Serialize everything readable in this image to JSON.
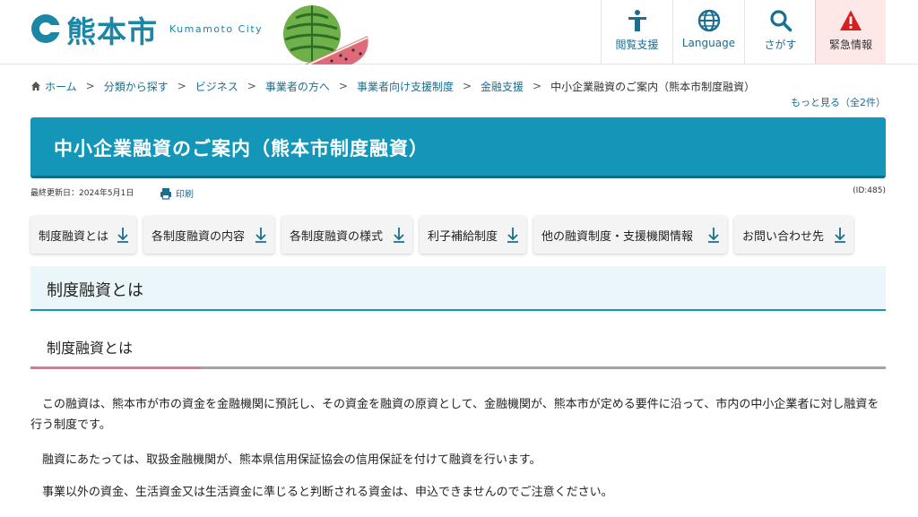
{
  "header": {
    "logo_text": "熊本市",
    "logo_sub": "Kumamoto City",
    "utilities": [
      {
        "label": "閲覧支援",
        "icon": "accessibility-icon"
      },
      {
        "label": "Language",
        "icon": "globe-icon"
      },
      {
        "label": "さがす",
        "icon": "search-icon"
      },
      {
        "label": "緊急情報",
        "icon": "warning-icon"
      }
    ]
  },
  "breadcrumb": {
    "items": [
      "ホーム",
      "分類から探す",
      "ビジネス",
      "事業者の方へ",
      "事業者向け支援制度",
      "金融支援"
    ],
    "current": "中小企業融資のご案内（熊本市制度融資）",
    "more": "もっと見る（全2件）"
  },
  "page": {
    "title": "中小企業融資のご案内（熊本市制度融資）",
    "updated": "最終更新日：2024年5月1日",
    "print": "印刷",
    "id": "(ID:485)"
  },
  "anchors": [
    "制度融資とは",
    "各制度融資の内容",
    "各制度融資の様式",
    "利子補給制度",
    "他の融資制度・支援機関情報",
    "お問い合わせ先"
  ],
  "content": {
    "h2": "制度融資とは",
    "h3": "制度融資とは",
    "p1": "この融資は、熊本市が市の資金を金融機関に預託し、その資金を融資の原資として、金融機関が、熊本市が定める要件に沿って、市内の中小企業者に対し融資を行う制度です。",
    "p2": "融資にあたっては、取扱金融機関が、熊本県信用保証協会の信用保証を付けて融資を行います。",
    "p3": "事業以外の資金、生活資金又は生活資金に準じると判断される資金は、申込できませんのでご注意ください。"
  },
  "colors": {
    "brand": "#1b86a6",
    "title_bar": "#1496b8",
    "link": "#1a6e90",
    "emergency_bg": "#fde7e7",
    "emergency_icon": "#d81e1e",
    "accent_pink": "#e2749a"
  }
}
